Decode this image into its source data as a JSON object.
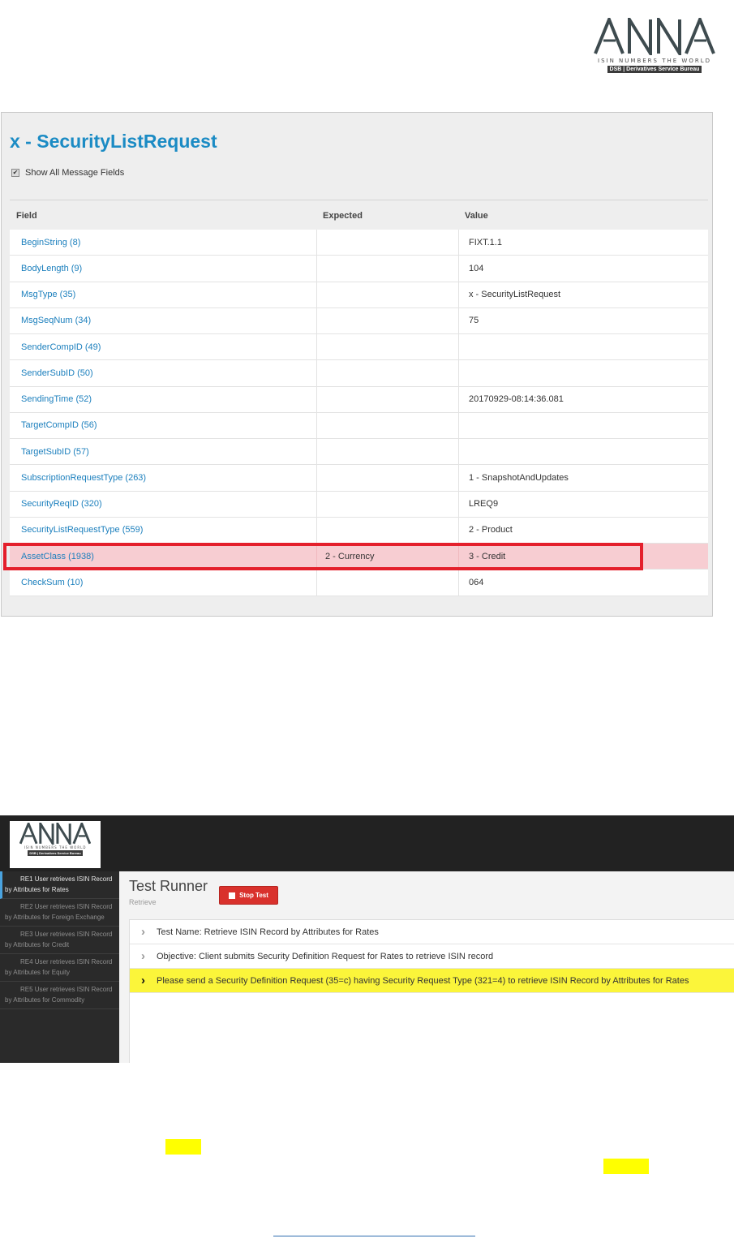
{
  "logo": {
    "wordmark": "ANNA",
    "tagline": "ISIN NUMBERS THE WORLD",
    "dsb": "DSB | Derivatives Service Bureau",
    "color": "#3e4b4f"
  },
  "message_panel": {
    "title": "x - SecurityListRequest",
    "show_all_label": "Show All Message Fields",
    "show_all_checked": true,
    "columns": {
      "field": "Field",
      "expected": "Expected",
      "value": "Value"
    },
    "rows": [
      {
        "field": "BeginString (8)",
        "expected": "",
        "value": "FIXT.1.1"
      },
      {
        "field": "BodyLength (9)",
        "expected": "",
        "value": "104"
      },
      {
        "field": "MsgType (35)",
        "expected": "",
        "value": "x - SecurityListRequest"
      },
      {
        "field": "MsgSeqNum (34)",
        "expected": "",
        "value": "75"
      },
      {
        "field": "SenderCompID (49)",
        "expected": "",
        "value": ""
      },
      {
        "field": "SenderSubID (50)",
        "expected": "",
        "value": ""
      },
      {
        "field": "SendingTime (52)",
        "expected": "",
        "value": "20170929-08:14:36.081"
      },
      {
        "field": "TargetCompID (56)",
        "expected": "",
        "value": ""
      },
      {
        "field": "TargetSubID (57)",
        "expected": "",
        "value": ""
      },
      {
        "field": "SubscriptionRequestType (263)",
        "expected": "",
        "value": "1 - SnapshotAndUpdates"
      },
      {
        "field": "SecurityReqID (320)",
        "expected": "",
        "value": "LREQ9"
      },
      {
        "field": "SecurityListRequestType (559)",
        "expected": "",
        "value": "2 - Product"
      },
      {
        "field": "AssetClass (1938)",
        "expected": "2 - Currency",
        "value": "3 - Credit"
      },
      {
        "field": "CheckSum (10)",
        "expected": "",
        "value": "064"
      }
    ],
    "colors": {
      "link": "#1b7fbd",
      "title": "#1b8bc4",
      "error_row": "#f7cdd2",
      "highlight_box": "#e4202c"
    }
  },
  "test_runner": {
    "sidebar_items": [
      "RE1 User retrieves ISIN Record by Attributes for Rates",
      "RE2 User retrieves ISIN Record by Attributes for Foreign Exchange",
      "RE3 User retrieves ISIN Record by Attributes for Credit",
      "RE4 User retrieves ISIN Record by Attributes for Equity",
      "RE5 User retrieves ISIN Record by Attributes for Commodity"
    ],
    "title": "Test Runner",
    "subtitle": "Retrieve",
    "stop_button": "Stop Test",
    "steps": [
      "Test Name: Retrieve ISIN Record by Attributes for Rates",
      "Objective: Client submits Security Definition Request for Rates to retrieve ISIN record",
      "Please send a Security Definition Request (35=c) having Security Request Type (321=4) to retrieve ISIN Record by Attributes for Rates"
    ],
    "colors": {
      "stop": "#d9312c",
      "current_step": "#fbf53a",
      "topbar": "#222222"
    }
  }
}
